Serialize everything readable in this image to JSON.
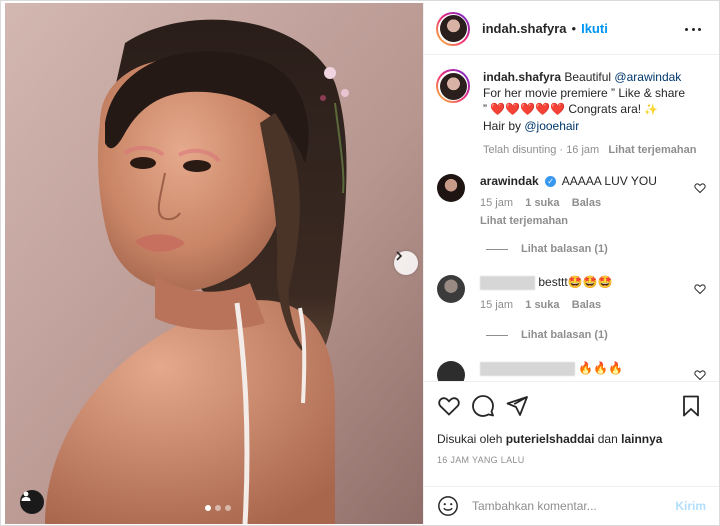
{
  "post": {
    "username": "indah.shafyra",
    "separator": "•",
    "follow_label": "Ikuti",
    "more_icon": "more-horizontal-icon"
  },
  "caption": {
    "username": "indah.shafyra",
    "text_prefix": "Beautiful ",
    "mention": "@arawindak",
    "line2": "For her movie premiere ” Like & share",
    "line3": "” ❤️❤️❤️❤️❤️ Congrats ara! ",
    "line4_prefix": "Hair by ",
    "hair_mention": "@jooehair",
    "edited": "Telah disunting",
    "dot": "·",
    "age": "16 jam",
    "translate": "Lihat terjemahan"
  },
  "comments": [
    {
      "username": "arawindak",
      "verified": true,
      "text": "AAAAA LUV YOU",
      "age": "15 jam",
      "likes": "1 suka",
      "reply": "Balas",
      "translate": "Lihat terjemahan",
      "view_replies": "Lihat balasan (1)"
    },
    {
      "username": "",
      "text": "besttt🤩🤩🤩",
      "age": "15 jam",
      "likes": "1 suka",
      "reply": "Balas",
      "view_replies": "Lihat balasan (1)"
    },
    {
      "username": "",
      "text": "🔥🔥🔥"
    }
  ],
  "actions": {
    "like_icon": "heart-icon",
    "comment_icon": "comment-icon",
    "share_icon": "send-icon",
    "save_icon": "bookmark-icon",
    "liked_by_prefix": "Disukai oleh",
    "liked_by_user": "puterielshaddai",
    "liked_by_and": "dan",
    "liked_by_others": "lainnya",
    "timestamp": "16 JAM YANG LALU"
  },
  "add_comment": {
    "placeholder": "Tambahkan komentar...",
    "post_label": "Kirim"
  },
  "media": {
    "carousel_count": 3,
    "active_index": 0
  },
  "colors": {
    "accent": "#0095f6",
    "verified": "#3897f0",
    "muted": "#8e8e8e"
  }
}
